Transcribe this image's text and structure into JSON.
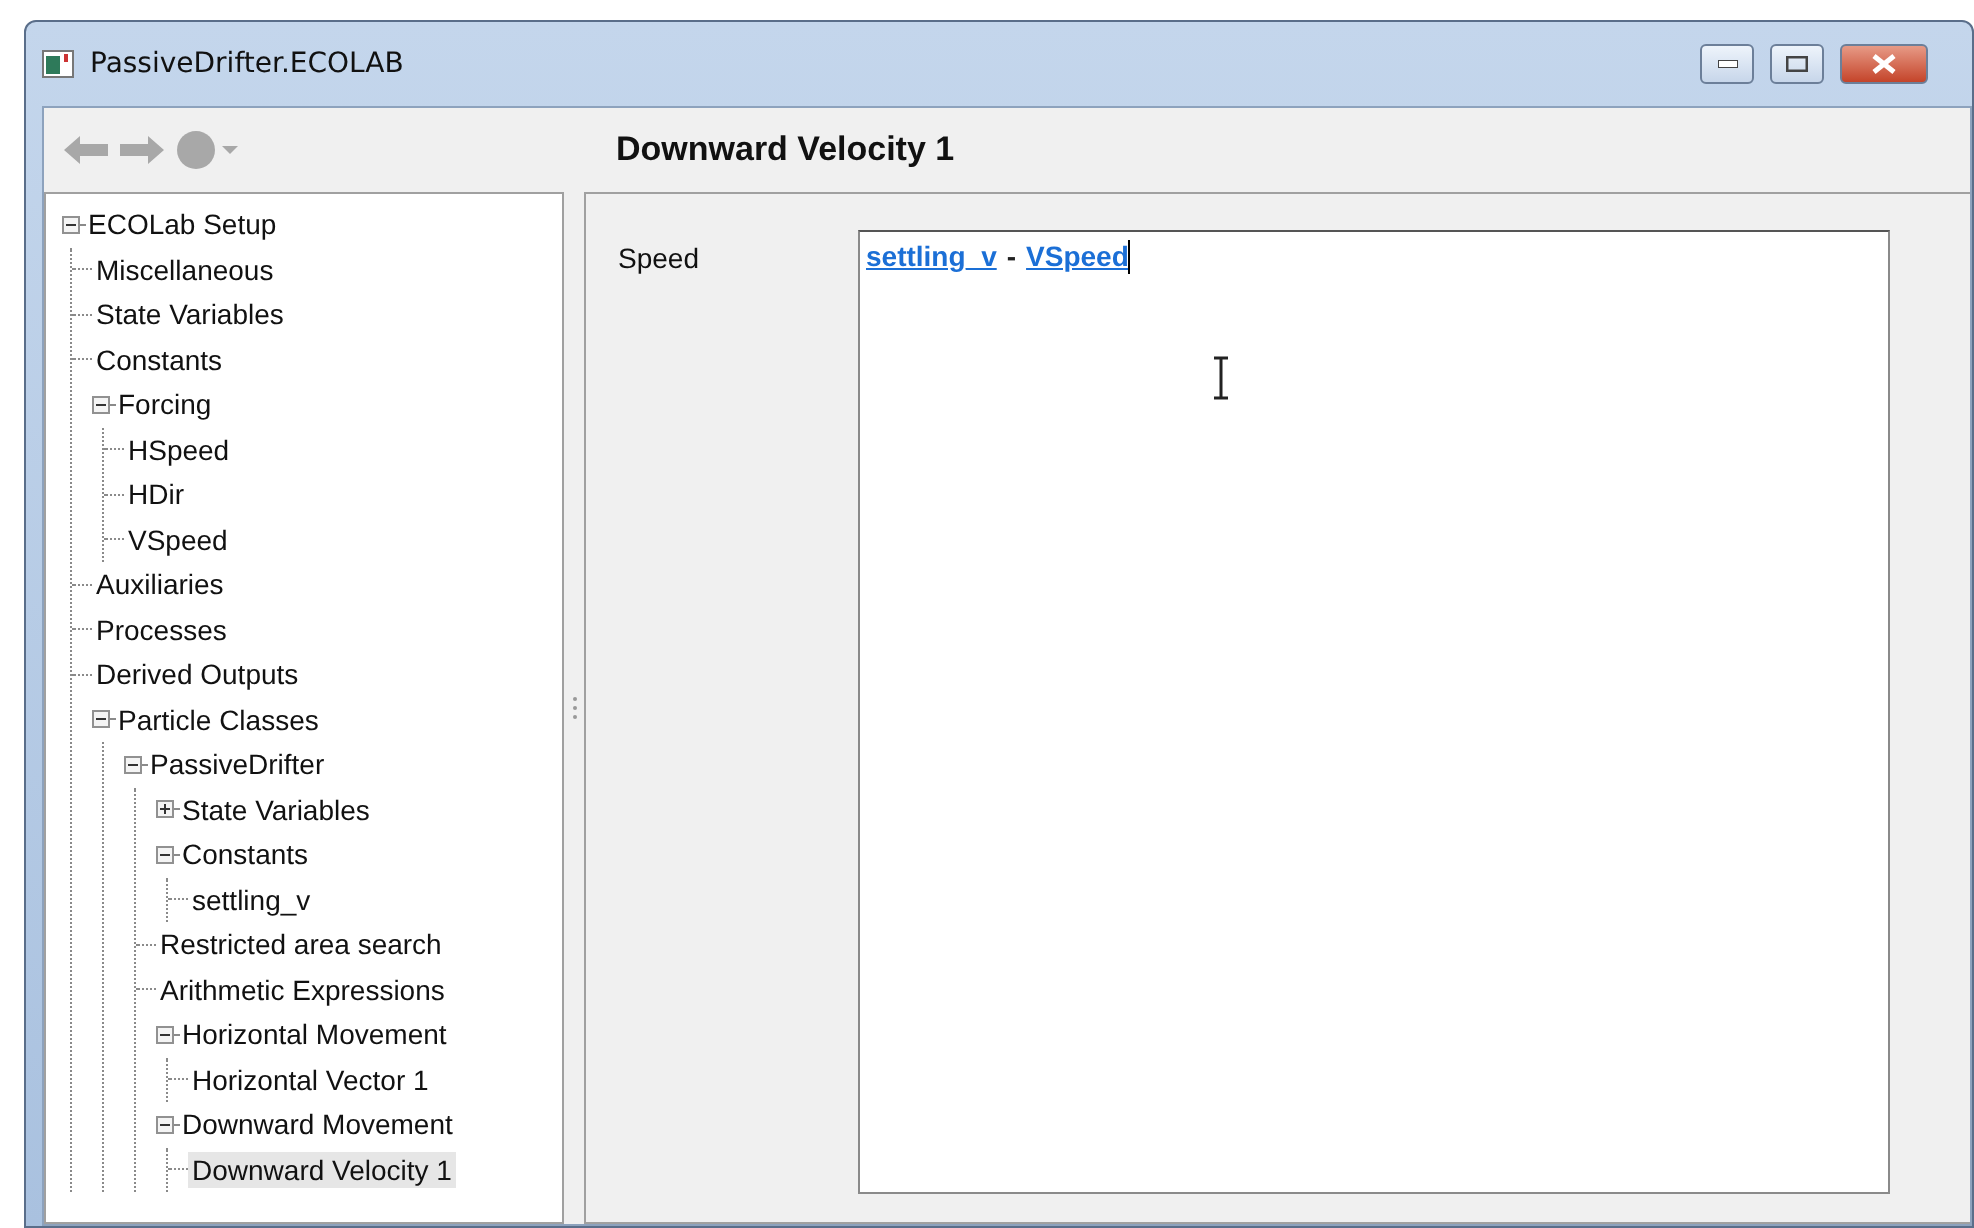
{
  "window": {
    "title": "PassiveDrifter.ECOLAB"
  },
  "toolbar": {
    "back_disabled": true,
    "forward_disabled": true
  },
  "tree": [
    {
      "label": "ECOLab Setup",
      "expanded": true,
      "selected": false,
      "children": [
        {
          "label": "Miscellaneous",
          "selected": false
        },
        {
          "label": "State Variables",
          "selected": false
        },
        {
          "label": "Constants",
          "selected": false
        },
        {
          "label": "Forcing",
          "expanded": true,
          "selected": false,
          "children": [
            {
              "label": "HSpeed",
              "selected": false
            },
            {
              "label": "HDir",
              "selected": false
            },
            {
              "label": "VSpeed",
              "selected": false
            }
          ]
        },
        {
          "label": "Auxiliaries",
          "selected": false
        },
        {
          "label": "Processes",
          "selected": false
        },
        {
          "label": "Derived Outputs",
          "selected": false
        },
        {
          "label": "Particle Classes",
          "expanded": true,
          "selected": false,
          "children": [
            {
              "label": "PassiveDrifter",
              "expanded": true,
              "selected": false,
              "children": [
                {
                  "label": "State Variables",
                  "expanded": false,
                  "selected": false
                },
                {
                  "label": "Constants",
                  "expanded": true,
                  "selected": false,
                  "children": [
                    {
                      "label": "settling_v",
                      "selected": false
                    }
                  ]
                },
                {
                  "label": "Restricted area search",
                  "selected": false
                },
                {
                  "label": "Arithmetic Expressions",
                  "selected": false
                },
                {
                  "label": "Horizontal Movement",
                  "expanded": true,
                  "selected": false,
                  "children": [
                    {
                      "label": "Horizontal Vector 1",
                      "selected": false
                    }
                  ]
                },
                {
                  "label": "Downward Movement",
                  "expanded": true,
                  "selected": false,
                  "children": [
                    {
                      "label": "Downward Velocity 1",
                      "selected": true
                    }
                  ]
                }
              ]
            }
          ]
        }
      ]
    }
  ],
  "panel": {
    "heading": "Downward Velocity 1",
    "field_label": "Speed",
    "expression": [
      {
        "kind": "link",
        "text": "settling_v"
      },
      {
        "kind": "text",
        "text": "-"
      },
      {
        "kind": "link",
        "text": "VSpeed"
      }
    ]
  }
}
